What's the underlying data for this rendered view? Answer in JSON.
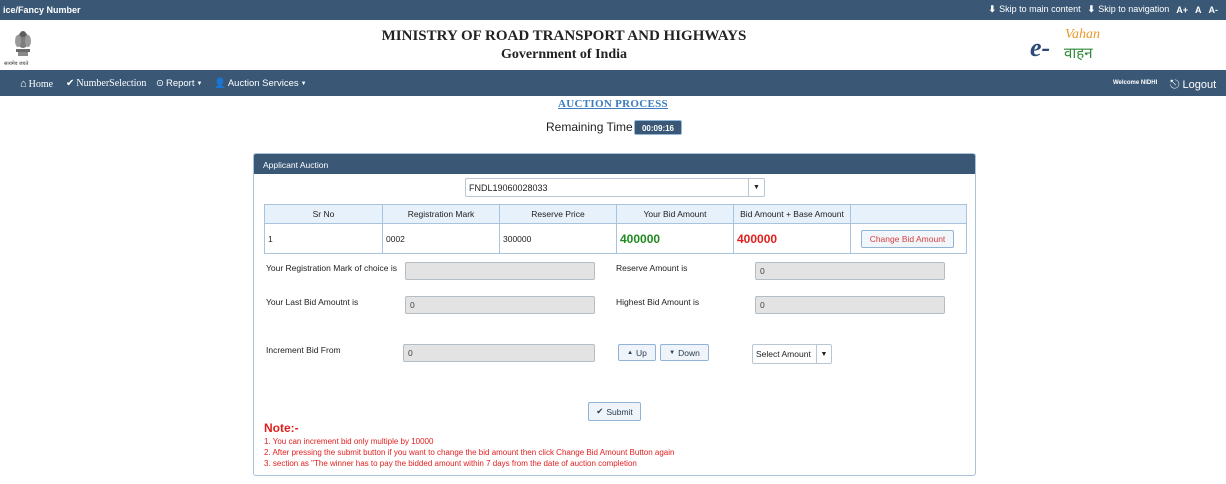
{
  "topbar": {
    "left_text": "ice/Fancy Number",
    "skip_main": "Skip to main content",
    "skip_nav": "Skip to navigation",
    "font_increase": "A+",
    "font_normal": "A",
    "font_decrease": "A-"
  },
  "header": {
    "emblem_caption": "सत्यमेव जयते",
    "title": "MINISTRY OF ROAD TRANSPORT AND HIGHWAYS",
    "subtitle": "Government of India",
    "logo_e": "e-",
    "logo_vahan": "Vahan",
    "logo_hindi": "वाहन"
  },
  "nav": {
    "home": "Home",
    "number_selection": "NumberSelection",
    "report": "Report",
    "auction_services": "Auction Services",
    "welcome": "Welcome NIDHI",
    "logout": "Logout"
  },
  "auction": {
    "title": "AUCTION PROCESS",
    "remaining_label": "Remaining Time",
    "remaining_time": "00:09:16"
  },
  "panel": {
    "heading": "Applicant Auction",
    "selected_number": "FNDL19060028033",
    "table": {
      "headers": [
        "Sr No",
        "Registration Mark",
        "Reserve Price",
        "Your Bid Amount",
        "Bid Amount + Base Amount"
      ],
      "rows": [
        {
          "sr": "1",
          "reg_mark": "0002",
          "reserve_price": "300000",
          "your_bid": "400000",
          "bid_plus_base": "400000"
        }
      ],
      "change_button": "Change Bid Amount"
    },
    "fields": {
      "reg_mark_label": "Your Registration Mark of choice is",
      "reg_mark_value": "",
      "reserve_label": "Reserve Amount is",
      "reserve_value": "0",
      "last_bid_label": "Your Last Bid Amoutnt is",
      "last_bid_value": "0",
      "highest_label": "Highest Bid Amount is",
      "highest_value": "0",
      "increment_label": "Increment Bid From",
      "increment_value": "0"
    },
    "up_label": "Up",
    "down_label": "Down",
    "select_amount": "Select Amount",
    "submit_label": "Submit",
    "note_title": "Note:-",
    "notes": [
      "1. You can increment bid only multiple by 10000",
      "2. After pressing the submit button if you want to change the bid amount then click Change Bid Amount Button again",
      "3. section as \"The winner has to pay the bidded amount within 7 days from the date of auction completion"
    ]
  },
  "colors": {
    "navbar": "#3a5876",
    "accent_blue": "#3b7dbf",
    "bid_green": "#1f8a1f",
    "bid_red": "#e01f1f"
  }
}
